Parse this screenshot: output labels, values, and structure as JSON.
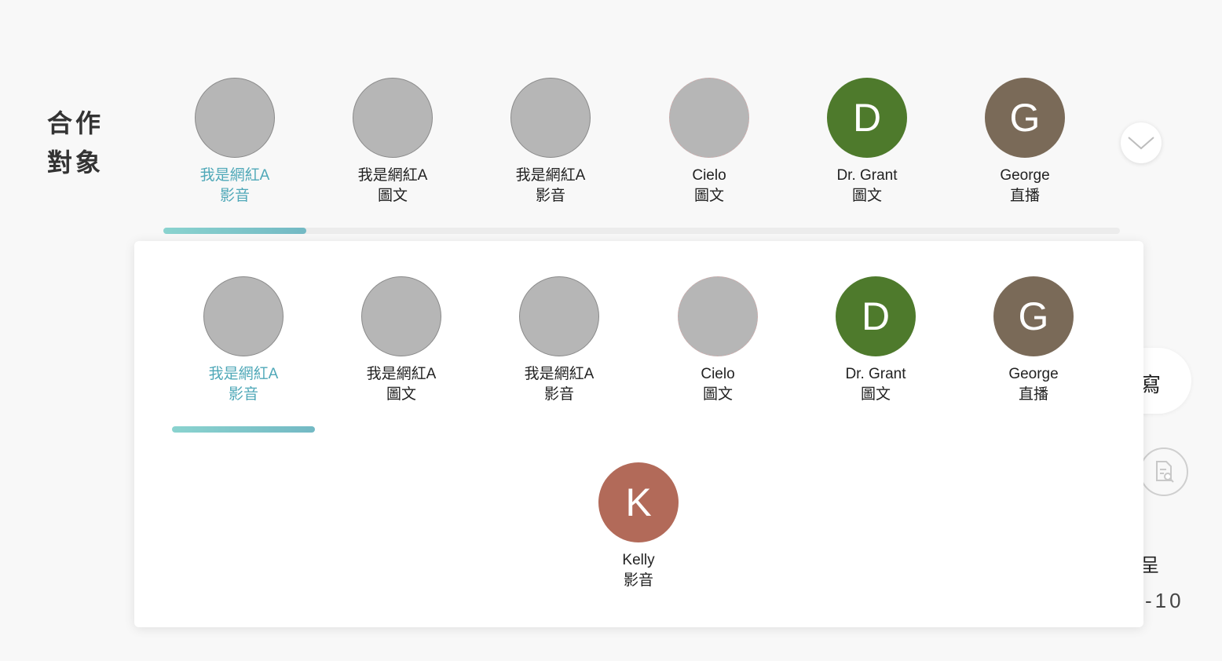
{
  "section": {
    "label_line1": "合作",
    "label_line2": "對象"
  },
  "creators": [
    {
      "name": "我是網紅A",
      "type": "影音",
      "initial": "",
      "avatar": "photo",
      "active": true
    },
    {
      "name": "我是網紅A",
      "type": "圖文",
      "initial": "",
      "avatar": "photo",
      "active": false
    },
    {
      "name": "我是網紅A",
      "type": "影音",
      "initial": "",
      "avatar": "photo",
      "active": false
    },
    {
      "name": "Cielo",
      "type": "圖文",
      "initial": "",
      "avatar": "photo",
      "active": false
    },
    {
      "name": "Dr. Grant",
      "type": "圖文",
      "initial": "D",
      "avatar": "#4e7a2c",
      "active": false
    },
    {
      "name": "George",
      "type": "直播",
      "initial": "G",
      "avatar": "#7a6a58",
      "active": false
    },
    {
      "name": "Kelly",
      "type": "影音",
      "initial": "K",
      "avatar": "#b26a59",
      "active": false
    }
  ],
  "colors": {
    "accent": "#4fa8b8",
    "scroll_gradient_start": "#8ad3cf",
    "scroll_gradient_end": "#73b9c4"
  },
  "right_side": {
    "partial_char_1": "寫",
    "partial_char_2": "呈",
    "partial_number": "-10"
  },
  "icons": {
    "expand": "chevron-down-icon",
    "preview": "document-search-icon"
  }
}
